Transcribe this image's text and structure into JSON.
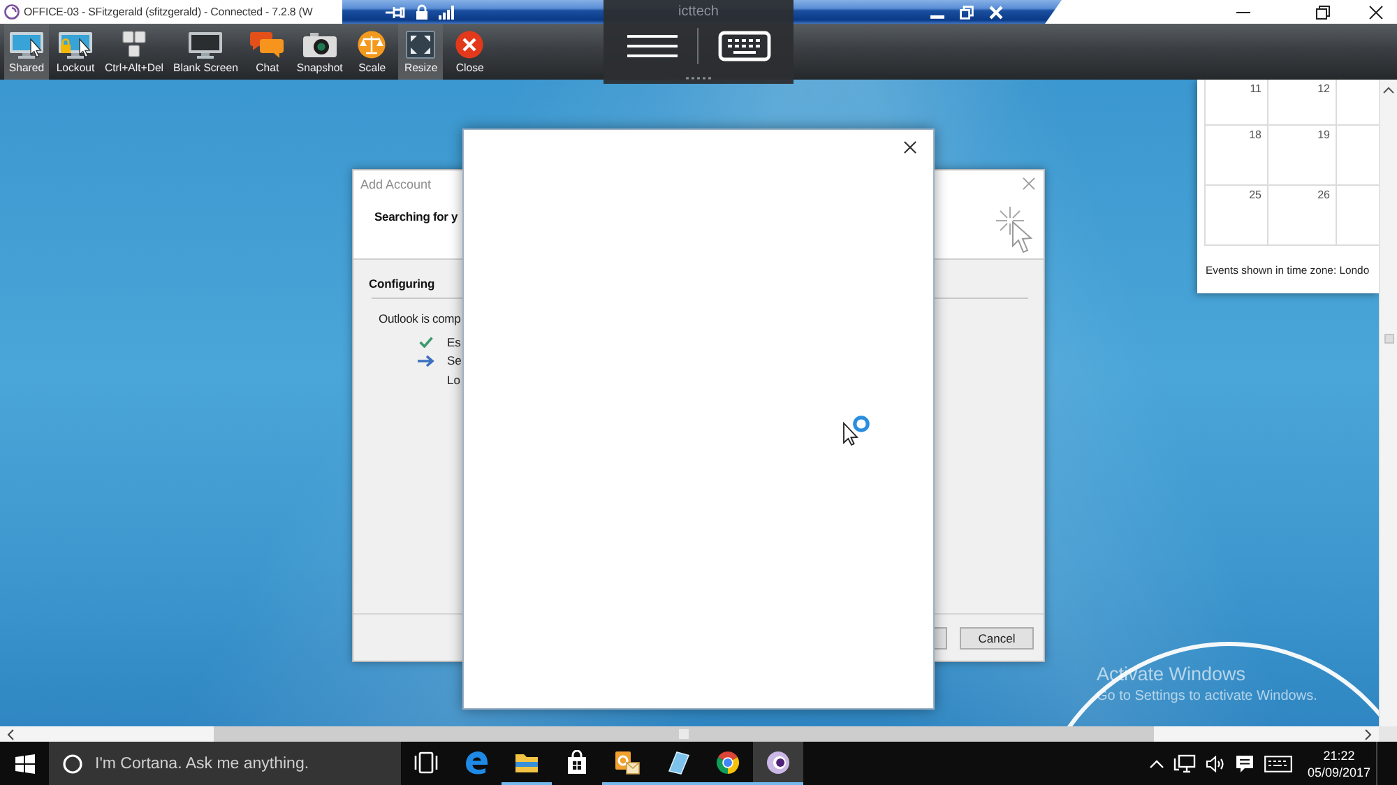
{
  "remote_session": {
    "title": "OFFICE-03 - SFitzgerald (sfitzgerald) - Connected - 7.2.8 (W",
    "panel_label": "icttech",
    "toolbar": [
      {
        "label": "Shared",
        "kind": "shared",
        "selected": true
      },
      {
        "label": "Lockout",
        "kind": "lockout",
        "selected": false
      },
      {
        "label": "Ctrl+Alt+Del",
        "kind": "keys",
        "selected": false
      },
      {
        "label": "Blank Screen",
        "kind": "monitor",
        "selected": false
      },
      {
        "label": "Chat",
        "kind": "chat",
        "selected": false
      },
      {
        "label": "Snapshot",
        "kind": "camera",
        "selected": false
      },
      {
        "label": "Scale",
        "kind": "scale",
        "selected": false
      },
      {
        "label": "Resize",
        "kind": "resize",
        "selected": true
      },
      {
        "label": "Close",
        "kind": "close",
        "selected": false
      }
    ]
  },
  "calendar": {
    "weeks": [
      {
        "days": [
          "11",
          "12"
        ]
      },
      {
        "days": [
          "18",
          "19"
        ]
      },
      {
        "days": [
          "25",
          "26"
        ]
      }
    ],
    "footer": "Events shown in time zone: Londo"
  },
  "dialog": {
    "title": "Add Account",
    "heading": "Searching for y",
    "section": "Configuring",
    "intro": "Outlook is comp",
    "steps": [
      {
        "text": "Es",
        "kind": "done"
      },
      {
        "text": "Se",
        "kind": "current"
      },
      {
        "text": "Lo",
        "kind": "pending"
      }
    ],
    "buttons": [
      {
        "label": "Cancel"
      }
    ]
  },
  "activation_notice": {
    "title": "Activate Windows",
    "text": "Go to Settings to activate Windows."
  },
  "taskbar": {
    "search": {
      "placeholder": "I'm Cortana. Ask me anything."
    },
    "apps": [
      {
        "kind": "task-view",
        "running": false,
        "selected": false
      },
      {
        "kind": "edge",
        "running": false,
        "selected": false
      },
      {
        "kind": "folder",
        "running": true,
        "selected": false
      },
      {
        "kind": "store",
        "running": false,
        "selected": false
      },
      {
        "kind": "mail",
        "running": true,
        "selected": false
      },
      {
        "kind": "tablet",
        "running": true,
        "selected": false
      },
      {
        "kind": "chrome",
        "running": true,
        "selected": false
      },
      {
        "kind": "eye",
        "running": true,
        "selected": true
      }
    ],
    "clock": {
      "time": "21:22",
      "date": "05/09/2017"
    }
  }
}
